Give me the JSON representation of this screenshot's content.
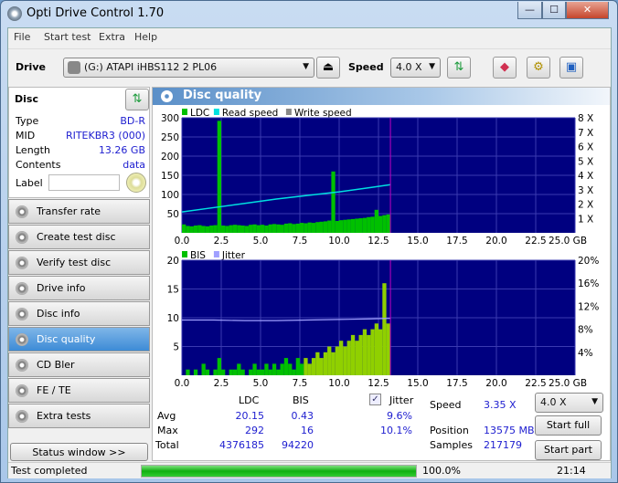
{
  "window": {
    "title": "Opti Drive Control 1.70",
    "minimize": "—",
    "maximize": "☐",
    "close": "✕"
  },
  "menu": [
    "File",
    "Start test",
    "Extra",
    "Help"
  ],
  "toolbar": {
    "drive_label": "Drive",
    "drive_value": "(G:)   ATAPI iHBS112   2 PL06",
    "speed_label": "Speed",
    "speed_value": "4.0 X",
    "icons": [
      "eject-icon",
      "refresh-icon",
      "eraser-icon",
      "settings-icon",
      "save-icon"
    ]
  },
  "disc": {
    "title": "Disc",
    "rows": [
      {
        "k": "Type",
        "v": "BD-R"
      },
      {
        "k": "MID",
        "v": "RITEKBR3 (000)"
      },
      {
        "k": "Length",
        "v": "13.26 GB"
      },
      {
        "k": "Contents",
        "v": "data"
      }
    ],
    "label_key": "Label",
    "label_value": ""
  },
  "nav": [
    {
      "label": "Transfer rate"
    },
    {
      "label": "Create test disc"
    },
    {
      "label": "Verify test disc"
    },
    {
      "label": "Drive info"
    },
    {
      "label": "Disc info"
    },
    {
      "label": "Disc quality",
      "active": true
    },
    {
      "label": "CD Bler"
    },
    {
      "label": "FE / TE"
    },
    {
      "label": "Extra tests"
    }
  ],
  "status_window_btn": "Status window >>",
  "panel_title": "Disc quality",
  "colors": {
    "ldc": "#00c000",
    "bis": "#00c000",
    "read_speed": "#00e0e0",
    "write_speed": "#888888",
    "jitter": "#a0a0ff",
    "plot_bg": "#000080",
    "marker": "#c000c0"
  },
  "chart_data": [
    {
      "type": "bar",
      "legend": [
        "LDC",
        "Read speed",
        "Write speed"
      ],
      "legend_placement": "top-left",
      "xlim": [
        0,
        25
      ],
      "xticks": [
        "0.0",
        "2.5",
        "5.0",
        "7.5",
        "10.0",
        "12.5",
        "15.0",
        "17.5",
        "20.0",
        "22.5",
        "25.0 GB"
      ],
      "ylim": [
        0,
        300
      ],
      "yticks": [
        "50",
        "100",
        "150",
        "200",
        "250",
        "300"
      ],
      "y2lim": [
        0,
        8
      ],
      "y2ticks": [
        "1 X",
        "2 X",
        "3 X",
        "4 X",
        "5 X",
        "6 X",
        "7 X",
        "8 X"
      ],
      "grid": true,
      "end_x": 13.26,
      "ldc_x_step": 0.25,
      "ldc": [
        22,
        18,
        17,
        19,
        20,
        18,
        17,
        19,
        20,
        292,
        19,
        18,
        20,
        21,
        20,
        19,
        18,
        21,
        22,
        20,
        21,
        19,
        22,
        23,
        22,
        21,
        24,
        25,
        23,
        24,
        26,
        25,
        27,
        26,
        28,
        29,
        30,
        32,
        160,
        31,
        33,
        34,
        35,
        36,
        37,
        38,
        39,
        41,
        42,
        60,
        44,
        46,
        48,
        47
      ],
      "read_speed": {
        "x": [
          0,
          2,
          4,
          6,
          8,
          10,
          12,
          13.26
        ],
        "y": [
          1.45,
          1.75,
          2.05,
          2.35,
          2.6,
          2.85,
          3.15,
          3.35
        ]
      }
    },
    {
      "type": "bar",
      "legend": [
        "BIS",
        "Jitter"
      ],
      "legend_placement": "top-left",
      "xlim": [
        0,
        25
      ],
      "xticks": [
        "0.0",
        "2.5",
        "5.0",
        "7.5",
        "10.0",
        "12.5",
        "15.0",
        "17.5",
        "20.0",
        "22.5",
        "25.0 GB"
      ],
      "ylim": [
        0,
        20
      ],
      "yticks": [
        "5",
        "10",
        "15",
        "20"
      ],
      "y2lim": [
        0,
        20
      ],
      "y2ticks": [
        "4%",
        "8%",
        "12%",
        "16%",
        "20%"
      ],
      "grid": true,
      "end_x": 13.26,
      "bis_x_step": 0.25,
      "bis": [
        0,
        1,
        0,
        1,
        0,
        2,
        1,
        0,
        1,
        3,
        1,
        0,
        1,
        1,
        2,
        1,
        0,
        1,
        2,
        1,
        1,
        2,
        1,
        2,
        1,
        2,
        3,
        2,
        1,
        3,
        2,
        3,
        2,
        3,
        4,
        3,
        4,
        5,
        4,
        5,
        6,
        5,
        6,
        7,
        6,
        7,
        8,
        7,
        8,
        9,
        8,
        16,
        9,
        6
      ],
      "jitter": {
        "x": [
          0,
          2,
          4,
          6,
          8,
          10,
          12,
          13.26
        ],
        "y": [
          9.6,
          9.6,
          9.5,
          9.5,
          9.6,
          9.7,
          9.8,
          9.9
        ]
      }
    }
  ],
  "stats": {
    "col_ldc": "LDC",
    "col_bis": "BIS",
    "avg_label": "Avg",
    "max_label": "Max",
    "total_label": "Total",
    "ldc_avg": "20.15",
    "ldc_max": "292",
    "ldc_total": "4376185",
    "bis_avg": "0.43",
    "bis_max": "16",
    "bis_total": "94220",
    "jitter_label": "Jitter",
    "jitter_checked": true,
    "jitter_avg": "9.6%",
    "jitter_max": "10.1%",
    "speed_label": "Speed",
    "speed_value": "3.35 X",
    "position_label": "Position",
    "position_value": "13575 MB",
    "samples_label": "Samples",
    "samples_value": "217179",
    "speed_select": "4.0 X",
    "start_full": "Start full",
    "start_part": "Start part"
  },
  "status": {
    "text": "Test completed",
    "progress": 100,
    "progress_text": "100.0%",
    "time": "21:14"
  }
}
